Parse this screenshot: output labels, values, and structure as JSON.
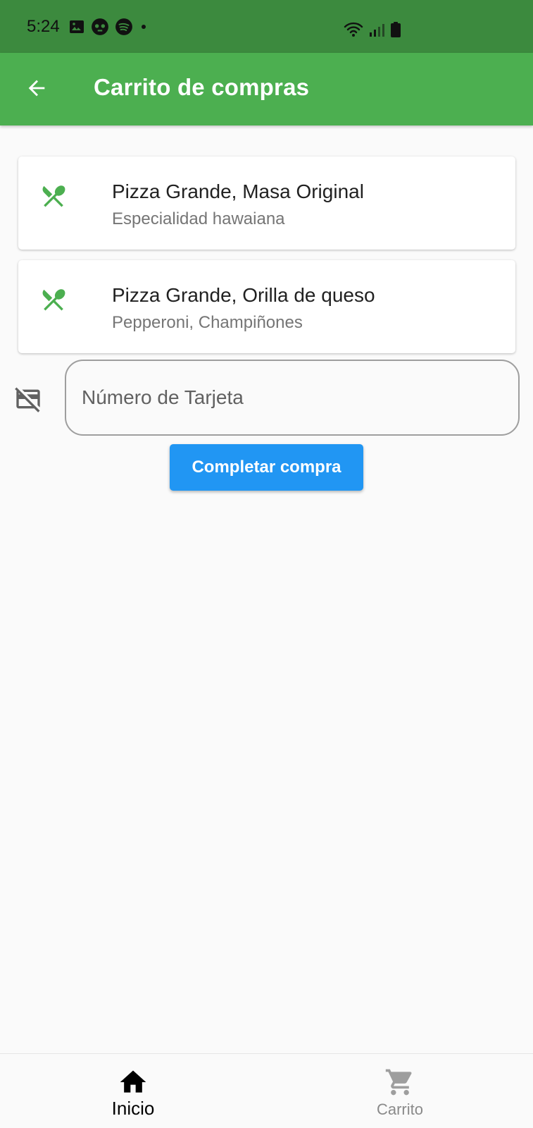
{
  "status_bar": {
    "time": "5:24",
    "left_icons": [
      "image-icon",
      "game-controller-icon",
      "spotify-icon",
      "dot-icon"
    ],
    "right_icons": [
      "wifi-icon",
      "signal-icon",
      "battery-icon"
    ]
  },
  "app_bar": {
    "title": "Carrito de compras",
    "back_icon": "arrow-back-icon",
    "color": "#4caf50"
  },
  "cart": {
    "items": [
      {
        "icon": "restaurant-icon",
        "title": "Pizza Grande, Masa Original",
        "subtitle": "Especialidad hawaiana"
      },
      {
        "icon": "restaurant-icon",
        "title": "Pizza Grande, Orilla de queso",
        "subtitle": "Pepperoni, Champiñones"
      }
    ],
    "icon_color": "#4caf50"
  },
  "payment": {
    "card_icon": "credit-card-off-icon",
    "card_placeholder": "Número de Tarjeta",
    "card_value": "",
    "submit_label": "Completar compra",
    "submit_color": "#2196f3"
  },
  "bottom_nav": {
    "items": [
      {
        "label": "Inicio",
        "icon": "home-icon",
        "active": true
      },
      {
        "label": "Carrito",
        "icon": "shopping-cart-icon",
        "active": false
      }
    ]
  }
}
